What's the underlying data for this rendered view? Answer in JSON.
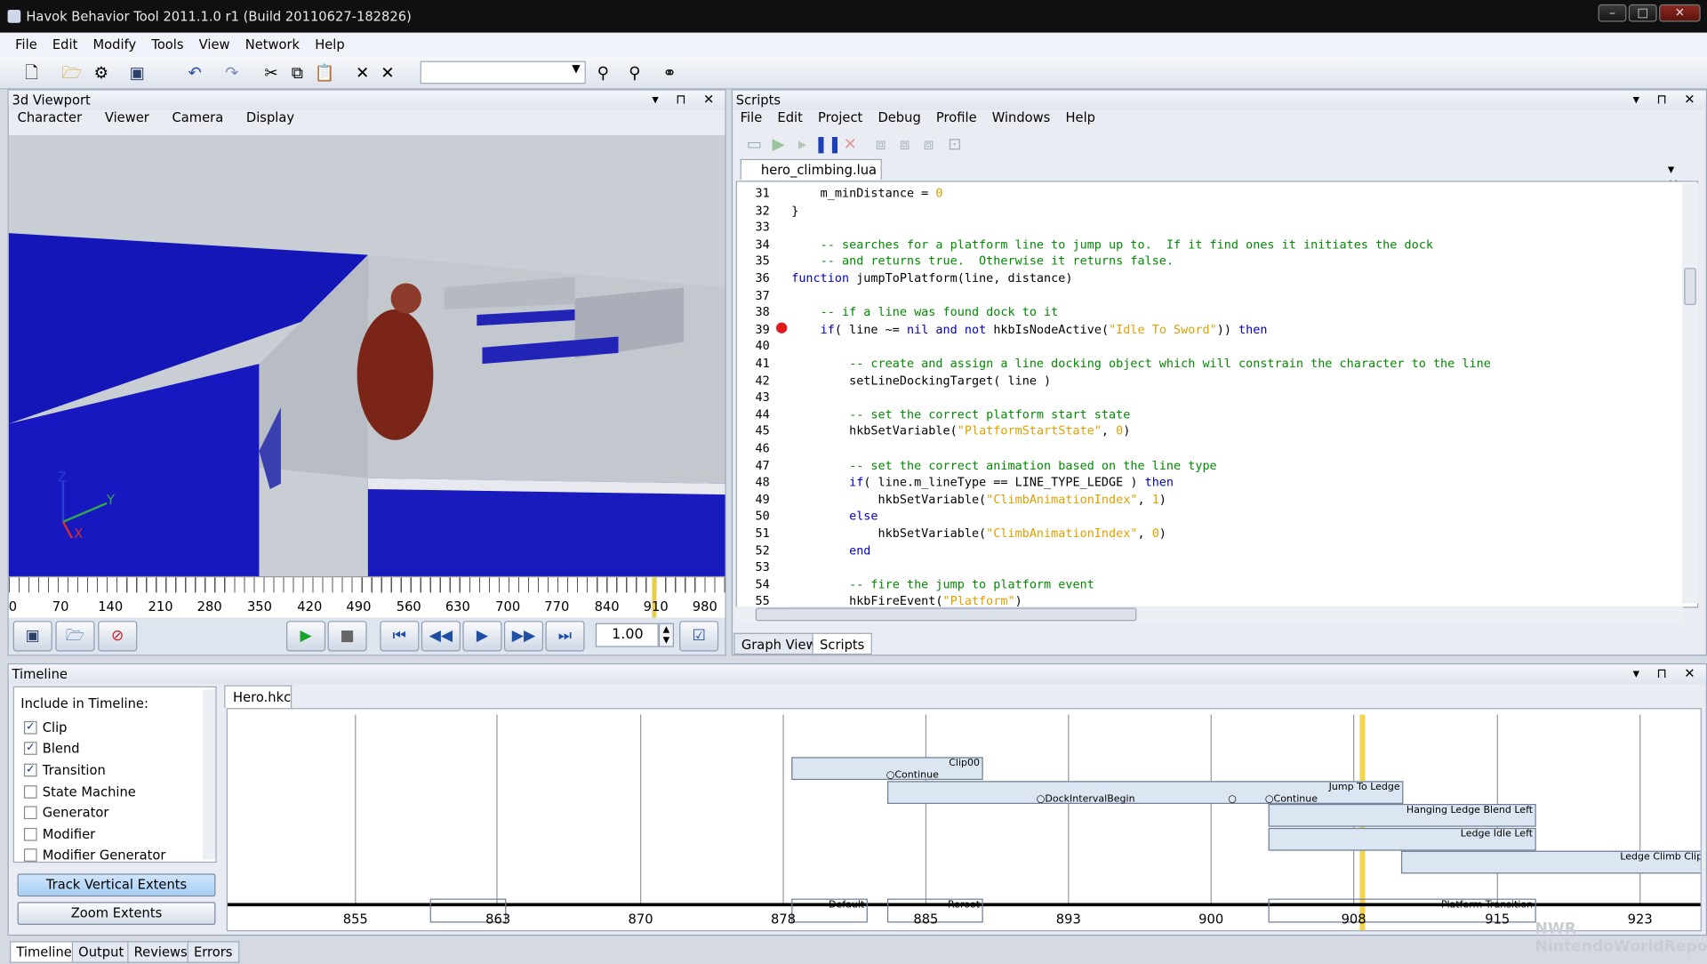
{
  "window": {
    "title": "Havok Behavior Tool 2011.1.0 r1 (Build 20110627-182826)"
  },
  "menu": [
    "File",
    "Edit",
    "Modify",
    "Tools",
    "View",
    "Network",
    "Help"
  ],
  "viewport": {
    "title": "3d Viewport",
    "menu": [
      "Character",
      "Viewer",
      "Camera",
      "Display"
    ],
    "axes": {
      "z": "Z",
      "y": "Y",
      "x": "X"
    },
    "ruler": [
      "0",
      "70",
      "140",
      "210",
      "280",
      "350",
      "420",
      "490",
      "560",
      "630",
      "700",
      "770",
      "840",
      "910",
      "980"
    ],
    "speed": "1.00"
  },
  "scripts": {
    "title": "Scripts",
    "menu": [
      "File",
      "Edit",
      "Project",
      "Debug",
      "Profile",
      "Windows",
      "Help"
    ],
    "file_tab": "hero_climbing.lua",
    "lines": [
      {
        "n": "31",
        "t": "    m_minDistance = 0"
      },
      {
        "n": "32",
        "t": "}"
      },
      {
        "n": "33",
        "t": ""
      },
      {
        "n": "34",
        "t": "    -- searches for a platform line to jump up to.  If it find ones it initiates the dock"
      },
      {
        "n": "35",
        "t": "    -- and returns true.  Otherwise it returns false."
      },
      {
        "n": "36",
        "t": "function jumpToPlatform(line, distance)"
      },
      {
        "n": "37",
        "t": ""
      },
      {
        "n": "38",
        "t": "    -- if a line was found dock to it"
      },
      {
        "n": "39",
        "t": "    if( line ~= nil and not hkbIsNodeActive(\"Idle To Sword\")) then"
      },
      {
        "n": "40",
        "t": ""
      },
      {
        "n": "41",
        "t": "        -- create and assign a line docking object which will constrain the character to the line"
      },
      {
        "n": "42",
        "t": "        setLineDockingTarget( line )"
      },
      {
        "n": "43",
        "t": ""
      },
      {
        "n": "44",
        "t": "        -- set the correct platform start state"
      },
      {
        "n": "45",
        "t": "        hkbSetVariable(\"PlatformStartState\", 0)"
      },
      {
        "n": "46",
        "t": ""
      },
      {
        "n": "47",
        "t": "        -- set the correct animation based on the line type"
      },
      {
        "n": "48",
        "t": "        if( line.m_lineType == LINE_TYPE_LEDGE ) then"
      },
      {
        "n": "49",
        "t": "            hkbSetVariable(\"ClimbAnimationIndex\", 1)"
      },
      {
        "n": "50",
        "t": "        else"
      },
      {
        "n": "51",
        "t": "            hkbSetVariable(\"ClimbAnimationIndex\", 0)"
      },
      {
        "n": "52",
        "t": "        end"
      },
      {
        "n": "53",
        "t": ""
      },
      {
        "n": "54",
        "t": "        -- fire the jump to platform event"
      },
      {
        "n": "55",
        "t": "        hkbFireEvent(\"Platform\")"
      }
    ],
    "bottom_tabs": [
      "Graph View",
      "Scripts"
    ]
  },
  "timeline": {
    "title": "Timeline",
    "include_label": "Include in Timeline:",
    "options": [
      {
        "label": "Clip",
        "checked": "✓"
      },
      {
        "label": "Blend",
        "checked": "✓"
      },
      {
        "label": "Transition",
        "checked": "✓"
      },
      {
        "label": "State Machine",
        "checked": ""
      },
      {
        "label": "Generator",
        "checked": ""
      },
      {
        "label": "Modifier",
        "checked": ""
      },
      {
        "label": "Modifier Generator",
        "checked": ""
      }
    ],
    "track_btn": "Track Vertical Extents",
    "zoom_btn": "Zoom Extents",
    "file_tab": "Hero.hkc",
    "clips": [
      "Clip00",
      "Continue",
      "Jump To Ledge",
      "DockIntervalBegin",
      "Continue",
      "Hanging Ledge Blend Left",
      "Ledge Idle Left",
      "Ledge Climb Clip",
      "Default",
      "Reroot",
      "Platform Transition"
    ],
    "ticks": [
      "855",
      "863",
      "870",
      "878",
      "885",
      "893",
      "900",
      "908",
      "915",
      "923"
    ]
  },
  "status_tabs": [
    "Timeline",
    "Output",
    "Reviews",
    "Errors"
  ],
  "watermark": "NWR NintendoWorldReport.com"
}
